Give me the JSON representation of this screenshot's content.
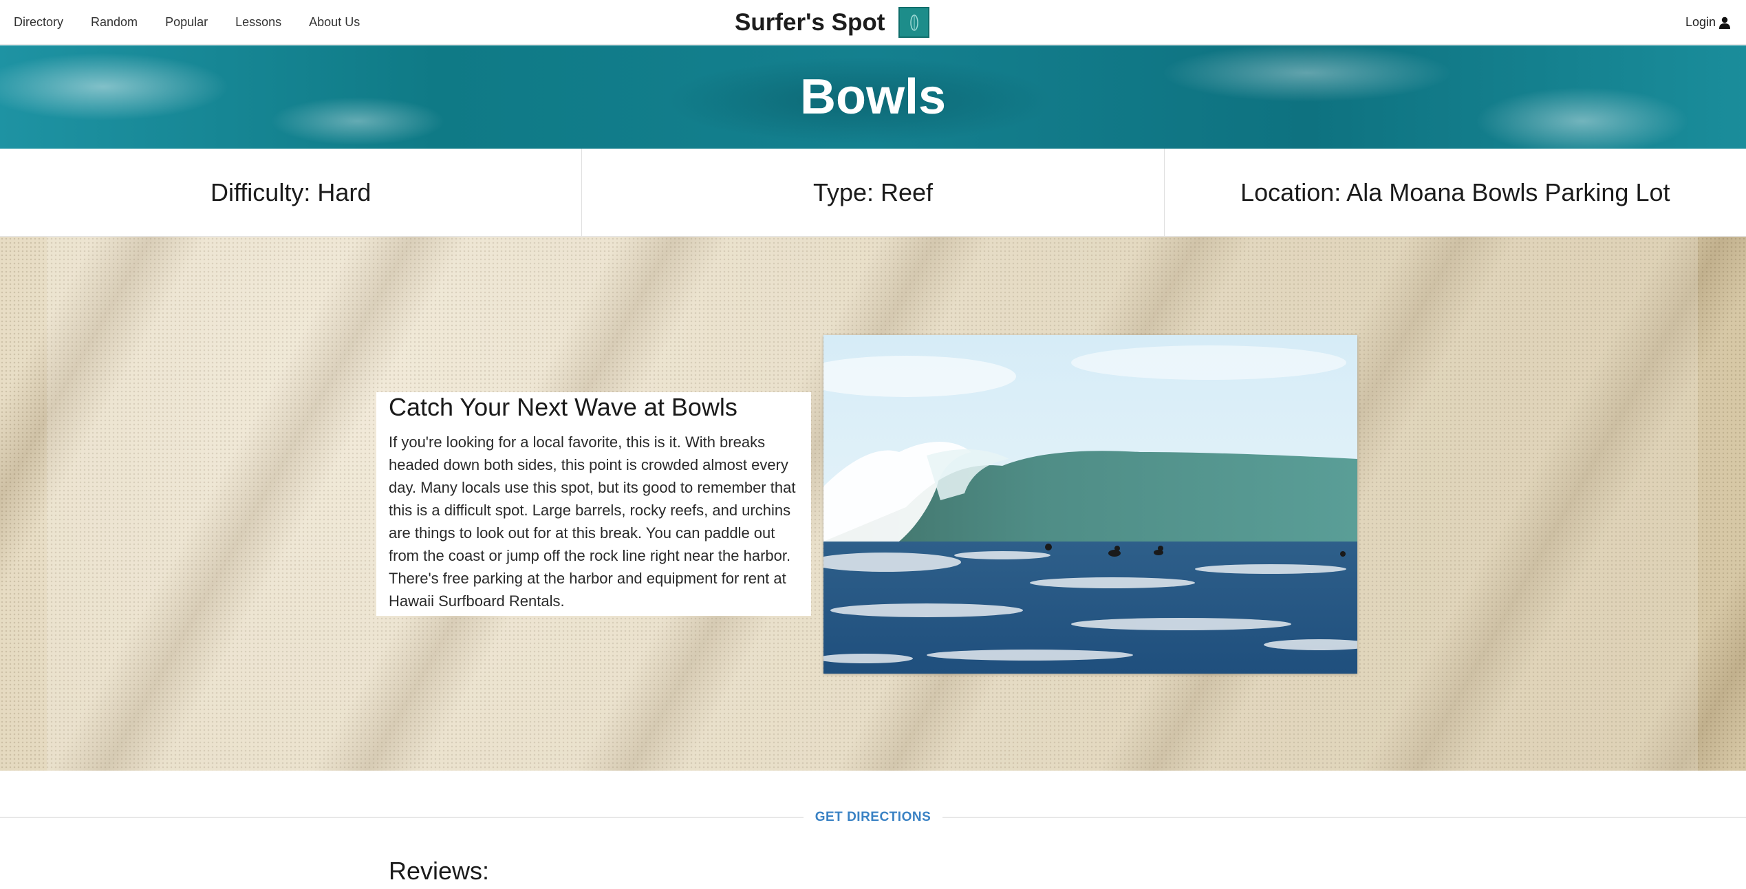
{
  "nav": {
    "items": [
      {
        "label": "Directory"
      },
      {
        "label": "Random"
      },
      {
        "label": "Popular"
      },
      {
        "label": "Lessons"
      },
      {
        "label": "About Us"
      }
    ],
    "brand": "Surfer's Spot",
    "login": "Login",
    "login_icon": "user-icon"
  },
  "hero": {
    "title": "Bowls"
  },
  "info": {
    "difficulty": "Difficulty: Hard",
    "type": "Type: Reef",
    "location": "Location: Ala Moana Bowls Parking Lot"
  },
  "description": {
    "heading": "Catch Your Next Wave at Bowls",
    "body": "If you're looking for a local favorite, this is it. With breaks headed down both sides, this point is crowded almost every day. Many locals use this spot, but its good to remember that this is a difficult spot. Large barrels, rocky reefs, and urchins are things to look out for at this break. You can paddle out from the coast or jump off the rock line right near the harbor. There's free parking at the harbor and equipment for rent at Hawaii Surfboard Rentals."
  },
  "directions": {
    "label": "GET DIRECTIONS"
  },
  "reviews": {
    "heading": "Reviews:"
  },
  "colors": {
    "brand_teal": "#1d8d8a",
    "link_blue": "#3a82c4"
  }
}
